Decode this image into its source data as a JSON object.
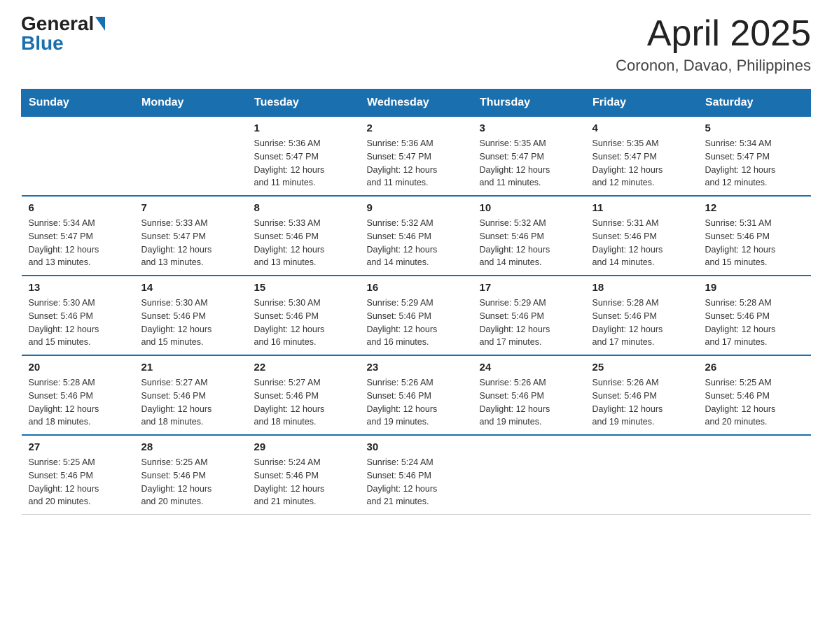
{
  "header": {
    "logo_general": "General",
    "logo_blue": "Blue",
    "title": "April 2025",
    "subtitle": "Coronon, Davao, Philippines"
  },
  "days_of_week": [
    "Sunday",
    "Monday",
    "Tuesday",
    "Wednesday",
    "Thursday",
    "Friday",
    "Saturday"
  ],
  "weeks": [
    {
      "days": [
        {
          "number": "",
          "info": ""
        },
        {
          "number": "",
          "info": ""
        },
        {
          "number": "1",
          "info": "Sunrise: 5:36 AM\nSunset: 5:47 PM\nDaylight: 12 hours\nand 11 minutes."
        },
        {
          "number": "2",
          "info": "Sunrise: 5:36 AM\nSunset: 5:47 PM\nDaylight: 12 hours\nand 11 minutes."
        },
        {
          "number": "3",
          "info": "Sunrise: 5:35 AM\nSunset: 5:47 PM\nDaylight: 12 hours\nand 11 minutes."
        },
        {
          "number": "4",
          "info": "Sunrise: 5:35 AM\nSunset: 5:47 PM\nDaylight: 12 hours\nand 12 minutes."
        },
        {
          "number": "5",
          "info": "Sunrise: 5:34 AM\nSunset: 5:47 PM\nDaylight: 12 hours\nand 12 minutes."
        }
      ]
    },
    {
      "days": [
        {
          "number": "6",
          "info": "Sunrise: 5:34 AM\nSunset: 5:47 PM\nDaylight: 12 hours\nand 13 minutes."
        },
        {
          "number": "7",
          "info": "Sunrise: 5:33 AM\nSunset: 5:47 PM\nDaylight: 12 hours\nand 13 minutes."
        },
        {
          "number": "8",
          "info": "Sunrise: 5:33 AM\nSunset: 5:46 PM\nDaylight: 12 hours\nand 13 minutes."
        },
        {
          "number": "9",
          "info": "Sunrise: 5:32 AM\nSunset: 5:46 PM\nDaylight: 12 hours\nand 14 minutes."
        },
        {
          "number": "10",
          "info": "Sunrise: 5:32 AM\nSunset: 5:46 PM\nDaylight: 12 hours\nand 14 minutes."
        },
        {
          "number": "11",
          "info": "Sunrise: 5:31 AM\nSunset: 5:46 PM\nDaylight: 12 hours\nand 14 minutes."
        },
        {
          "number": "12",
          "info": "Sunrise: 5:31 AM\nSunset: 5:46 PM\nDaylight: 12 hours\nand 15 minutes."
        }
      ]
    },
    {
      "days": [
        {
          "number": "13",
          "info": "Sunrise: 5:30 AM\nSunset: 5:46 PM\nDaylight: 12 hours\nand 15 minutes."
        },
        {
          "number": "14",
          "info": "Sunrise: 5:30 AM\nSunset: 5:46 PM\nDaylight: 12 hours\nand 15 minutes."
        },
        {
          "number": "15",
          "info": "Sunrise: 5:30 AM\nSunset: 5:46 PM\nDaylight: 12 hours\nand 16 minutes."
        },
        {
          "number": "16",
          "info": "Sunrise: 5:29 AM\nSunset: 5:46 PM\nDaylight: 12 hours\nand 16 minutes."
        },
        {
          "number": "17",
          "info": "Sunrise: 5:29 AM\nSunset: 5:46 PM\nDaylight: 12 hours\nand 17 minutes."
        },
        {
          "number": "18",
          "info": "Sunrise: 5:28 AM\nSunset: 5:46 PM\nDaylight: 12 hours\nand 17 minutes."
        },
        {
          "number": "19",
          "info": "Sunrise: 5:28 AM\nSunset: 5:46 PM\nDaylight: 12 hours\nand 17 minutes."
        }
      ]
    },
    {
      "days": [
        {
          "number": "20",
          "info": "Sunrise: 5:28 AM\nSunset: 5:46 PM\nDaylight: 12 hours\nand 18 minutes."
        },
        {
          "number": "21",
          "info": "Sunrise: 5:27 AM\nSunset: 5:46 PM\nDaylight: 12 hours\nand 18 minutes."
        },
        {
          "number": "22",
          "info": "Sunrise: 5:27 AM\nSunset: 5:46 PM\nDaylight: 12 hours\nand 18 minutes."
        },
        {
          "number": "23",
          "info": "Sunrise: 5:26 AM\nSunset: 5:46 PM\nDaylight: 12 hours\nand 19 minutes."
        },
        {
          "number": "24",
          "info": "Sunrise: 5:26 AM\nSunset: 5:46 PM\nDaylight: 12 hours\nand 19 minutes."
        },
        {
          "number": "25",
          "info": "Sunrise: 5:26 AM\nSunset: 5:46 PM\nDaylight: 12 hours\nand 19 minutes."
        },
        {
          "number": "26",
          "info": "Sunrise: 5:25 AM\nSunset: 5:46 PM\nDaylight: 12 hours\nand 20 minutes."
        }
      ]
    },
    {
      "days": [
        {
          "number": "27",
          "info": "Sunrise: 5:25 AM\nSunset: 5:46 PM\nDaylight: 12 hours\nand 20 minutes."
        },
        {
          "number": "28",
          "info": "Sunrise: 5:25 AM\nSunset: 5:46 PM\nDaylight: 12 hours\nand 20 minutes."
        },
        {
          "number": "29",
          "info": "Sunrise: 5:24 AM\nSunset: 5:46 PM\nDaylight: 12 hours\nand 21 minutes."
        },
        {
          "number": "30",
          "info": "Sunrise: 5:24 AM\nSunset: 5:46 PM\nDaylight: 12 hours\nand 21 minutes."
        },
        {
          "number": "",
          "info": ""
        },
        {
          "number": "",
          "info": ""
        },
        {
          "number": "",
          "info": ""
        }
      ]
    }
  ]
}
